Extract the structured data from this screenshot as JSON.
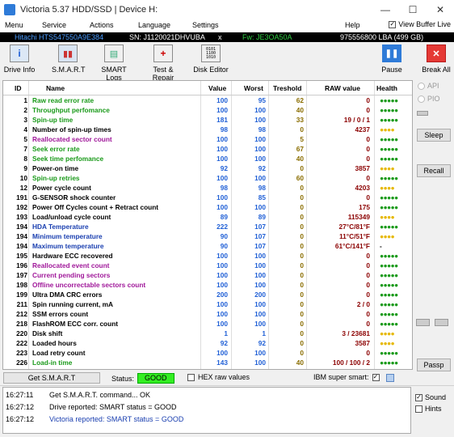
{
  "window": {
    "title": "Victoria 5.37 HDD/SSD | Device H:",
    "icon": "victoria-app-icon"
  },
  "menu": {
    "items": [
      "Menu",
      "Service",
      "Actions",
      "Language",
      "Settings",
      "Help"
    ],
    "view_buffer_live": "View Buffer Live",
    "view_buffer_checked": true
  },
  "device": {
    "model": "Hitachi HTS547550A9E384",
    "serial": "SN: J1120021DHVUBA",
    "close": "x",
    "firmware": "Fw: JE3OA50A",
    "capacity": "975556800 LBA (499 GB)"
  },
  "toolbar": {
    "drive_info": "Drive Info",
    "smart": "S.M.A.R.T",
    "smart_logs": "SMART Logs",
    "test_repair": "Test & Repair",
    "disk_editor": "Disk Editor",
    "pause": "Pause",
    "break_all": "Break All"
  },
  "table": {
    "headers": {
      "id": "ID",
      "name": "Name",
      "value": "Value",
      "worst": "Worst",
      "threshold": "Treshold",
      "raw": "RAW value",
      "health": "Health"
    },
    "rows": [
      {
        "id": "1",
        "name": "Raw read error rate",
        "value": "100",
        "worst": "95",
        "thr": "62",
        "raw": "0",
        "health": "●●●●●",
        "nc": "#1a9a1a",
        "hc": "#1a9a1a"
      },
      {
        "id": "2",
        "name": "Throughput perfomance",
        "value": "100",
        "worst": "100",
        "thr": "40",
        "raw": "0",
        "health": "●●●●●",
        "nc": "#1a9a1a",
        "hc": "#1a9a1a"
      },
      {
        "id": "3",
        "name": "Spin-up time",
        "value": "181",
        "worst": "100",
        "thr": "33",
        "raw": "19 / 0 / 1",
        "health": "●●●●●",
        "nc": "#1a9a1a",
        "hc": "#1a9a1a"
      },
      {
        "id": "4",
        "name": "Number of spin-up times",
        "value": "98",
        "worst": "98",
        "thr": "0",
        "raw": "4237",
        "health": "●●●●",
        "nc": "#000000",
        "hc": "#e6b800"
      },
      {
        "id": "5",
        "name": "Reallocated sector count",
        "value": "100",
        "worst": "100",
        "thr": "5",
        "raw": "0",
        "health": "●●●●●",
        "nc": "#a0189a",
        "hc": "#1a9a1a"
      },
      {
        "id": "7",
        "name": "Seek error rate",
        "value": "100",
        "worst": "100",
        "thr": "67",
        "raw": "0",
        "health": "●●●●●",
        "nc": "#1a9a1a",
        "hc": "#1a9a1a"
      },
      {
        "id": "8",
        "name": "Seek time perfomance",
        "value": "100",
        "worst": "100",
        "thr": "40",
        "raw": "0",
        "health": "●●●●●",
        "nc": "#1a9a1a",
        "hc": "#1a9a1a"
      },
      {
        "id": "9",
        "name": "Power-on time",
        "value": "92",
        "worst": "92",
        "thr": "0",
        "raw": "3857",
        "health": "●●●●",
        "nc": "#000000",
        "hc": "#e6b800"
      },
      {
        "id": "10",
        "name": "Spin-up retries",
        "value": "100",
        "worst": "100",
        "thr": "60",
        "raw": "0",
        "health": "●●●●●",
        "nc": "#1a9a1a",
        "hc": "#1a9a1a"
      },
      {
        "id": "12",
        "name": "Power cycle count",
        "value": "98",
        "worst": "98",
        "thr": "0",
        "raw": "4203",
        "health": "●●●●",
        "nc": "#000000",
        "hc": "#e6b800"
      },
      {
        "id": "191",
        "name": "G-SENSOR shock counter",
        "value": "100",
        "worst": "85",
        "thr": "0",
        "raw": "0",
        "health": "●●●●●",
        "nc": "#000000",
        "hc": "#1a9a1a"
      },
      {
        "id": "192",
        "name": "Power Off Cycles count + Retract count",
        "value": "100",
        "worst": "100",
        "thr": "0",
        "raw": "175",
        "health": "●●●●●",
        "nc": "#000000",
        "hc": "#1a9a1a"
      },
      {
        "id": "193",
        "name": "Load/unload cycle count",
        "value": "89",
        "worst": "89",
        "thr": "0",
        "raw": "115349",
        "health": "●●●●",
        "nc": "#000000",
        "hc": "#e6b800"
      },
      {
        "id": "194",
        "name": "HDA Temperature",
        "value": "222",
        "worst": "107",
        "thr": "0",
        "raw": "27°C/81°F",
        "health": "●●●●●",
        "nc": "#1a3fb0",
        "hc": "#1a9a1a"
      },
      {
        "id": "194",
        "name": "Minimum temperature",
        "value": "90",
        "worst": "107",
        "thr": "0",
        "raw": "11°C/51°F",
        "health": "●●●●",
        "nc": "#1a3fb0",
        "hc": "#e6b800"
      },
      {
        "id": "194",
        "name": "Maximum temperature",
        "value": "90",
        "worst": "107",
        "thr": "0",
        "raw": "61°C/141°F",
        "health": "-",
        "nc": "#1a3fb0",
        "hc": "#000000"
      },
      {
        "id": "195",
        "name": "Hardware ECC recovered",
        "value": "100",
        "worst": "100",
        "thr": "0",
        "raw": "0",
        "health": "●●●●●",
        "nc": "#000000",
        "hc": "#1a9a1a"
      },
      {
        "id": "196",
        "name": "Reallocated event count",
        "value": "100",
        "worst": "100",
        "thr": "0",
        "raw": "0",
        "health": "●●●●●",
        "nc": "#a0189a",
        "hc": "#1a9a1a"
      },
      {
        "id": "197",
        "name": "Current pending sectors",
        "value": "100",
        "worst": "100",
        "thr": "0",
        "raw": "0",
        "health": "●●●●●",
        "nc": "#a0189a",
        "hc": "#1a9a1a"
      },
      {
        "id": "198",
        "name": "Offline uncorrectable sectors count",
        "value": "100",
        "worst": "100",
        "thr": "0",
        "raw": "0",
        "health": "●●●●●",
        "nc": "#a0189a",
        "hc": "#1a9a1a"
      },
      {
        "id": "199",
        "name": "Ultra DMA CRC errors",
        "value": "200",
        "worst": "200",
        "thr": "0",
        "raw": "0",
        "health": "●●●●●",
        "nc": "#000000",
        "hc": "#1a9a1a"
      },
      {
        "id": "211",
        "name": "Spin running current, mA",
        "value": "100",
        "worst": "100",
        "thr": "0",
        "raw": "2 / 0",
        "health": "●●●●●",
        "nc": "#000000",
        "hc": "#1a9a1a"
      },
      {
        "id": "212",
        "name": "SSM errors count",
        "value": "100",
        "worst": "100",
        "thr": "0",
        "raw": "0",
        "health": "●●●●●",
        "nc": "#000000",
        "hc": "#1a9a1a"
      },
      {
        "id": "218",
        "name": "FlashROM ECC corr. count",
        "value": "100",
        "worst": "100",
        "thr": "0",
        "raw": "0",
        "health": "●●●●●",
        "nc": "#000000",
        "hc": "#1a9a1a"
      },
      {
        "id": "220",
        "name": "Disk shift",
        "value": "1",
        "worst": "1",
        "thr": "0",
        "raw": "3 / 23681",
        "health": "●●●●",
        "nc": "#000000",
        "hc": "#e6b800"
      },
      {
        "id": "222",
        "name": "Loaded hours",
        "value": "92",
        "worst": "92",
        "thr": "0",
        "raw": "3587",
        "health": "●●●●",
        "nc": "#000000",
        "hc": "#e6b800"
      },
      {
        "id": "223",
        "name": "Load retry count",
        "value": "100",
        "worst": "100",
        "thr": "0",
        "raw": "0",
        "health": "●●●●●",
        "nc": "#000000",
        "hc": "#1a9a1a"
      },
      {
        "id": "226",
        "name": "Load-in time",
        "value": "143",
        "worst": "100",
        "thr": "40",
        "raw": "100 / 100 / 2",
        "health": "●●●●●",
        "nc": "#1a9a1a",
        "hc": "#1a9a1a"
      }
    ]
  },
  "side": {
    "api": "API",
    "pio": "PIO",
    "sleep": "Sleep",
    "recall": "Recall",
    "passp": "Passp"
  },
  "status": {
    "get_smart": "Get S.M.A.R.T",
    "status_label": "Status:",
    "status_value": "GOOD",
    "hex_raw": "HEX raw values",
    "ibm": "IBM super smart:",
    "ibm_checked": true
  },
  "log": [
    {
      "time": "16:27:11",
      "msg": "Get S.M.A.R.T. command... OK",
      "color": "#000000"
    },
    {
      "time": "16:27:12",
      "msg": "Drive reported: SMART status = GOOD",
      "color": "#000000"
    },
    {
      "time": "16:27:12",
      "msg": "Victoria reported: SMART status = GOOD",
      "color": "#1a3fb0"
    }
  ],
  "options": {
    "sound": "Sound",
    "sound_checked": true,
    "hints": "Hints",
    "hints_checked": false
  },
  "colors": {
    "good": "#33ee22",
    "infobar_bg": "#000000",
    "model": "#4a9cff",
    "firmware": "#2ecc40",
    "capacity": "#ffffff"
  }
}
